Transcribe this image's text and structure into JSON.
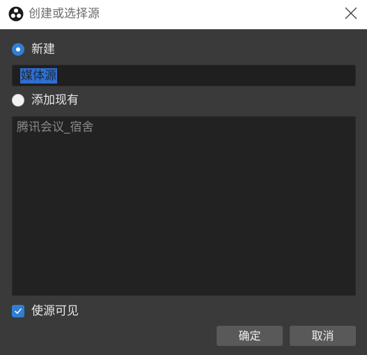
{
  "window": {
    "title": "创建或选择源",
    "logo_icon": "obs-logo-icon",
    "close_icon": "close-icon"
  },
  "create_new": {
    "label": "新建",
    "checked": true
  },
  "name_input": {
    "value": "媒体源",
    "selected": true
  },
  "add_existing": {
    "label": "添加现有",
    "checked": false
  },
  "existing_sources": {
    "items": [
      "腾讯会议_宿舍"
    ]
  },
  "visible_checkbox": {
    "label": "使源可见",
    "checked": true
  },
  "buttons": {
    "ok_label": "确定",
    "cancel_label": "取消"
  },
  "colors": {
    "background": "#3a3a3a",
    "accent": "#2f7fd6",
    "input_bg": "#1f1f1f",
    "button_bg": "#595959",
    "titlebar_bg": "#ffffff"
  }
}
